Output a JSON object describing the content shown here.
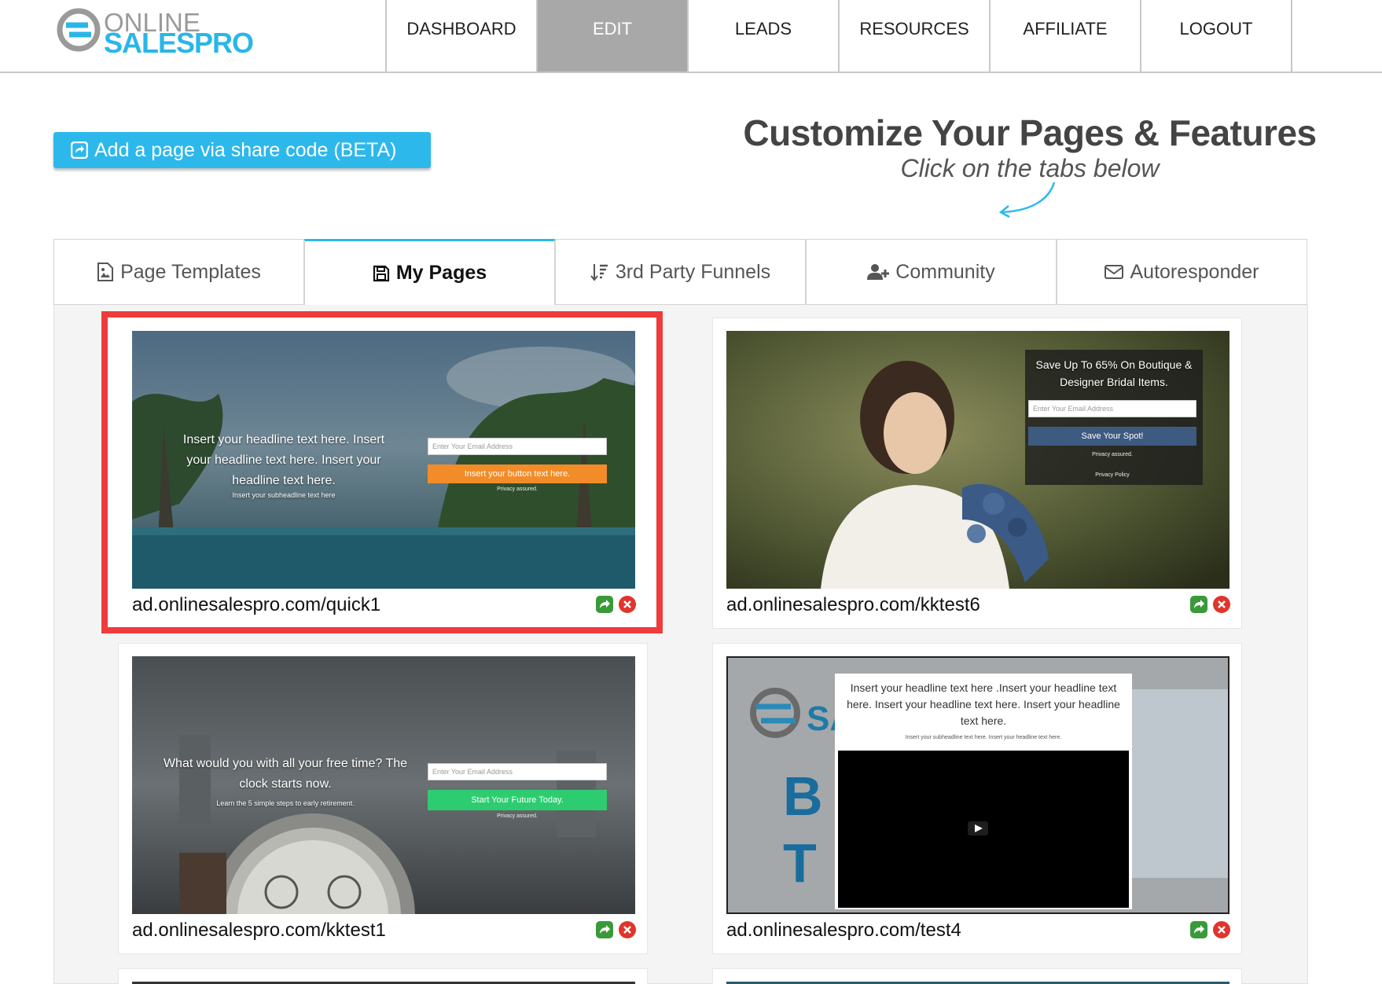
{
  "logo": {
    "line1": "ONLINE",
    "line2": "SALESPRO"
  },
  "nav": {
    "items": [
      {
        "label": "DASHBOARD",
        "active": false
      },
      {
        "label": "EDIT",
        "active": true
      },
      {
        "label": "LEADS",
        "active": false
      },
      {
        "label": "RESOURCES",
        "active": false
      },
      {
        "label": "AFFILIATE",
        "active": false
      },
      {
        "label": "LOGOUT",
        "active": false
      }
    ]
  },
  "hero": {
    "share_button": "Add a page via share code (BETA)",
    "title": "Customize Your Pages & Features",
    "subtitle": "Click on the tabs below"
  },
  "tabs": [
    {
      "label": "Page Templates",
      "icon": "image-file-icon",
      "active": false
    },
    {
      "label": "My Pages",
      "icon": "floppy-disk-icon",
      "active": true
    },
    {
      "label": "3rd Party Funnels",
      "icon": "sort-amount-icon",
      "active": false
    },
    {
      "label": "Community",
      "icon": "user-plus-icon",
      "active": false
    },
    {
      "label": "Autoresponder",
      "icon": "envelope-icon",
      "active": false
    }
  ],
  "pages": [
    {
      "url": "ad.onlinesalespro.com/quick1",
      "selected": true,
      "headline": "Insert your headline text here. Insert your headline text here. Insert your headline text here.",
      "subheadline": "Insert your subheadline text here",
      "email_placeholder": "Enter Your Email Address",
      "button": "Insert your button text here.",
      "privacy": "Privacy assured."
    },
    {
      "url": "ad.onlinesalespro.com/kktest6",
      "selected": false,
      "headline": "Save Up To 65% On Boutique & Designer Bridal Items.",
      "email_placeholder": "Enter Your Email Address",
      "button": "Save Your Spot!",
      "privacy": "Privacy assured.",
      "policy": "Privacy Policy"
    },
    {
      "url": "ad.onlinesalespro.com/kktest1",
      "selected": false,
      "headline": "What would you with all your free time? The clock starts now.",
      "subheadline": "Learn the 5 simple steps to early retirement.",
      "email_placeholder": "Enter Your Email Address",
      "button": "Start Your Future Today.",
      "privacy": "Privacy assured."
    },
    {
      "url": "ad.onlinesalespro.com/test4",
      "selected": false,
      "headline": "Insert your headline text here .Insert your headline text here. Insert your headline text here. Insert your headline text here.",
      "subheadline": "Insert your subheadline text here. Insert your headline text here."
    }
  ],
  "colors": {
    "accent": "#2db8ec",
    "nav_active": "#a8a8a8",
    "selected_border": "#ee3b3b",
    "orange_button": "#f28c28",
    "green_button": "#2ecc71",
    "navy_button": "#3d5a80"
  }
}
